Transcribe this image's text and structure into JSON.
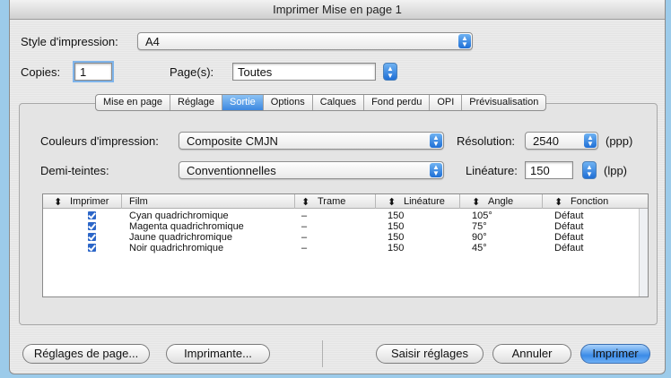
{
  "window": {
    "title": "Imprimer Mise en page 1"
  },
  "style_row": {
    "label": "Style d'impression:",
    "value": "A4"
  },
  "copies": {
    "label": "Copies:",
    "value": "1"
  },
  "pages": {
    "label": "Page(s):",
    "value": "Toutes"
  },
  "tabs": [
    {
      "label": "Mise en page"
    },
    {
      "label": "Réglage"
    },
    {
      "label": "Sortie",
      "active": true
    },
    {
      "label": "Options"
    },
    {
      "label": "Calques"
    },
    {
      "label": "Fond perdu"
    },
    {
      "label": "OPI"
    },
    {
      "label": "Prévisualisation"
    }
  ],
  "output": {
    "colors_label": "Couleurs d'impression:",
    "colors_value": "Composite CMJN",
    "halftone_label": "Demi-teintes:",
    "halftone_value": "Conventionnelles",
    "resolution_label": "Résolution:",
    "resolution_value": "2540",
    "resolution_unit": "(ppp)",
    "lineature_label": "Linéature:",
    "lineature_value": "150",
    "lineature_unit": "(lpp)"
  },
  "table": {
    "headers": {
      "print": "Imprimer",
      "film": "Film",
      "screen": "Trame",
      "lineature": "Linéature",
      "angle": "Angle",
      "function": "Fonction"
    },
    "sort_glyph": "⬍",
    "rows": [
      {
        "film": "Cyan quadrichromique",
        "screen": "–",
        "lineature": "150",
        "angle": "105°",
        "function": "Défaut"
      },
      {
        "film": "Magenta quadrichromique",
        "screen": "–",
        "lineature": "150",
        "angle": "75°",
        "function": "Défaut"
      },
      {
        "film": "Jaune quadrichromique",
        "screen": "–",
        "lineature": "150",
        "angle": "90°",
        "function": "Défaut"
      },
      {
        "film": "Noir quadrichromique",
        "screen": "–",
        "lineature": "150",
        "angle": "45°",
        "function": "Défaut"
      }
    ]
  },
  "buttons": {
    "page_setup": "Réglages de page...",
    "printer": "Imprimante...",
    "capture": "Saisir réglages",
    "cancel": "Annuler",
    "print": "Imprimer"
  },
  "colors": {
    "desktop": "#9ccbea",
    "accent": "#3d88e0"
  }
}
